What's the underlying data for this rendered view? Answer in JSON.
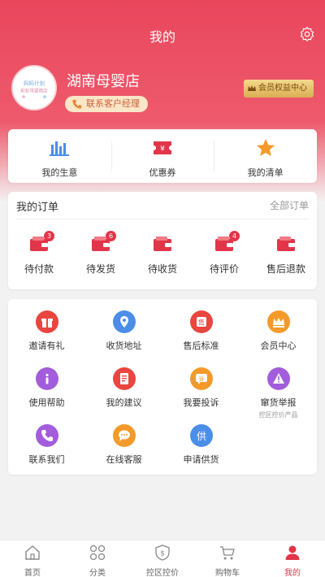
{
  "header": {
    "title": "我的"
  },
  "profile": {
    "shop_name": "湖南母婴店",
    "contact_button": "联系客户经理",
    "vip_button": "会员权益中心"
  },
  "quick_links": [
    {
      "label": "我的生意",
      "icon": "bar-chart-icon"
    },
    {
      "label": "优惠券",
      "icon": "coupon-icon"
    },
    {
      "label": "我的清单",
      "icon": "star-icon"
    }
  ],
  "orders": {
    "title": "我的订单",
    "all_link": "全部订单",
    "items": [
      {
        "label": "待付款",
        "badge": "3"
      },
      {
        "label": "待发货",
        "badge": "6"
      },
      {
        "label": "待收货",
        "badge": ""
      },
      {
        "label": "待评价",
        "badge": "4"
      },
      {
        "label": "售后退款",
        "badge": ""
      }
    ]
  },
  "services": [
    {
      "label": "邀请有礼",
      "icon": "gift-icon",
      "color": "#e8463f"
    },
    {
      "label": "收货地址",
      "icon": "location-pin-icon",
      "color": "#4c8de8"
    },
    {
      "label": "售后标准",
      "icon": "after-sale-icon",
      "color": "#e8463f"
    },
    {
      "label": "会员中心",
      "icon": "crown-icon",
      "color": "#f39a2b"
    },
    {
      "label": "使用帮助",
      "icon": "info-icon",
      "color": "#a25ddc"
    },
    {
      "label": "我的建议",
      "icon": "document-icon",
      "color": "#e8463f"
    },
    {
      "label": "我要投诉",
      "icon": "complaint-icon",
      "color": "#f39a2b"
    },
    {
      "label": "窜货举报",
      "icon": "warning-icon",
      "color": "#a25ddc",
      "sub": "控区控价产品"
    },
    {
      "label": "联系我们",
      "icon": "phone-icon",
      "color": "#a25ddc"
    },
    {
      "label": "在线客服",
      "icon": "chat-icon",
      "color": "#f39a2b"
    },
    {
      "label": "申请供货",
      "icon": "supply-icon",
      "color": "#4c8de8"
    }
  ],
  "avatar_text": "妈妈计划 彩虹母婴商店",
  "bottom_nav": [
    {
      "label": "首页",
      "icon": "home-icon",
      "active": false
    },
    {
      "label": "分类",
      "icon": "category-icon",
      "active": false
    },
    {
      "label": "控区控价",
      "icon": "shield-price-icon",
      "active": false
    },
    {
      "label": "购物车",
      "icon": "cart-icon",
      "active": false
    },
    {
      "label": "我的",
      "icon": "user-icon",
      "active": true
    }
  ],
  "colors": {
    "brand": "#e9465c",
    "badge": "#e2354a"
  }
}
